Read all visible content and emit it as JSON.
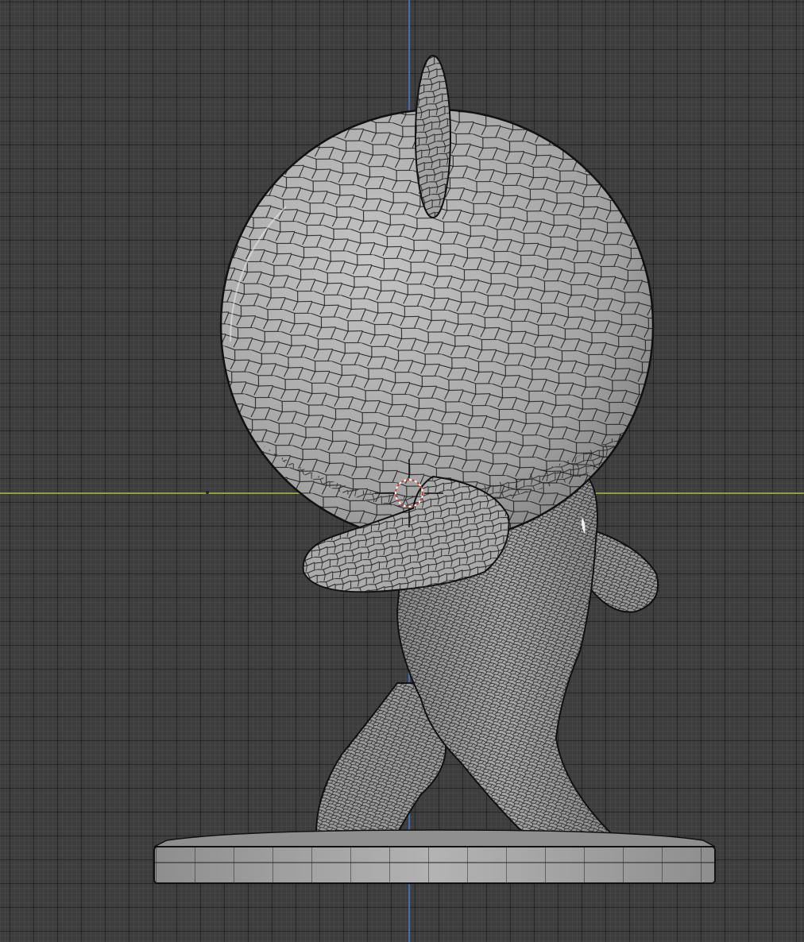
{
  "viewport": {
    "mode": "3d-viewport",
    "grid": true,
    "shading": "solid-wireframe-overlay",
    "object": "character-sculpt-mesh",
    "colors": {
      "background": "#3d3d3d",
      "grid_line": "#2c2c2c",
      "x_axis": "#8da03a",
      "z_axis": "#3f6fb0",
      "mesh_fill": "#a7a7a7",
      "wire": "#1e1e1e",
      "cursor_ring": "#d23a3a"
    },
    "icons": [
      "3d-cursor-icon",
      "origin-dot-icon"
    ]
  }
}
